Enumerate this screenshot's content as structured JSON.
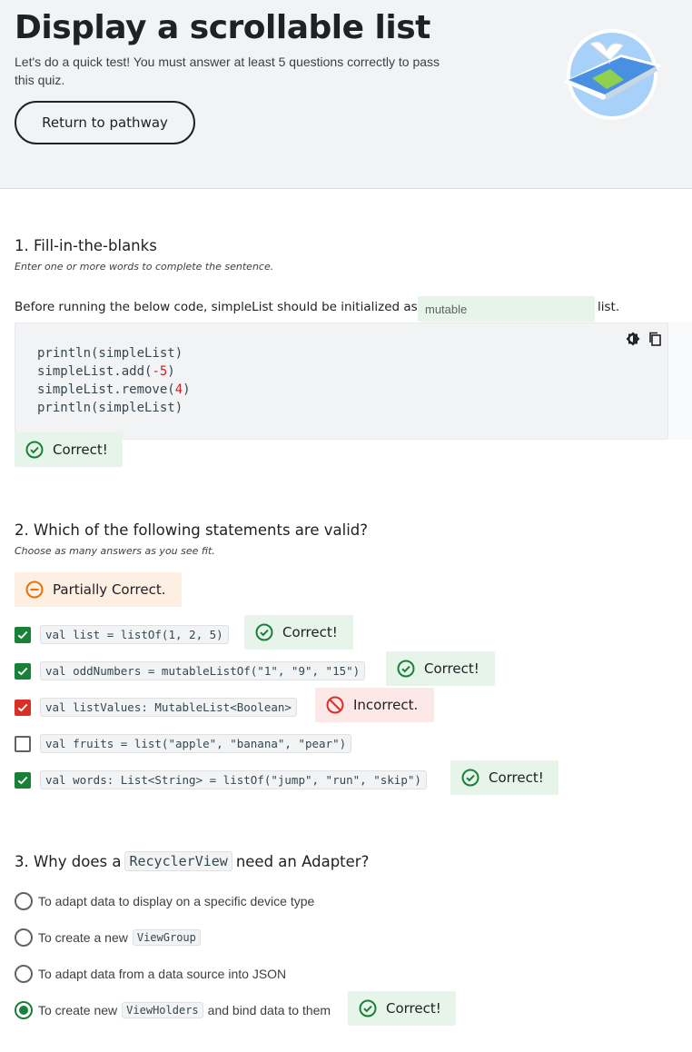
{
  "header": {
    "title": "Display a scrollable list",
    "subtitle": "Let's do a quick test! You must answer at least 5 questions correctly to pass this quiz.",
    "return_button": "Return to pathway"
  },
  "q1": {
    "title": "1. Fill-in-the-blanks",
    "hint": "Enter one or more words to complete the sentence.",
    "sentence_prefix": "Before running the below code, simpleList should be initialized as a",
    "input_value": "mutable",
    "sentence_suffix": "list.",
    "code": {
      "line1": "println(simpleList)",
      "line2_a": "simpleList.add(",
      "line2_num": "-5",
      "line2_b": ")",
      "line3_a": "simpleList.remove(",
      "line3_num": "4",
      "line3_b": ")",
      "line4": "println(simpleList)"
    },
    "result": "Correct!"
  },
  "q2": {
    "title": "2. Which of the following statements are valid?",
    "hint": "Choose as many answers as you see fit.",
    "overall_result": "Partially Correct.",
    "options": [
      {
        "code": "val list = listOf(1, 2, 5)",
        "checked": true,
        "result": "Correct!"
      },
      {
        "code": "val oddNumbers = mutableListOf(\"1\", \"9\", \"15\")",
        "checked": true,
        "result": "Correct!"
      },
      {
        "code": "val listValues: MutableList<Boolean>",
        "checked": true,
        "result": "Incorrect."
      },
      {
        "code": "val fruits = list(\"apple\", \"banana\", \"pear\")",
        "checked": false,
        "result": ""
      },
      {
        "code": "val words: List<String> = listOf(\"jump\", \"run\", \"skip\")",
        "checked": true,
        "result": "Correct!"
      }
    ]
  },
  "q3": {
    "title_prefix": "3. Why does a",
    "title_code": "RecyclerView",
    "title_suffix": "need an Adapter?",
    "options": {
      "o1": "To adapt data to display on a specific device type",
      "o2_prefix": "To create a new",
      "o2_code": "ViewGroup",
      "o3": "To adapt data from a data source into JSON",
      "o4_prefix": "To create new",
      "o4_code": "ViewHolders",
      "o4_suffix": "and bind data to them"
    },
    "result": "Correct!"
  },
  "colors": {
    "correct_green": "#188038",
    "incorrect_red": "#d93025",
    "partial_orange": "#e8710a"
  },
  "icons": [
    "illustration-phone-bird-icon",
    "theme-toggle-icon",
    "copy-icon",
    "check-circle-icon",
    "minus-circle-icon",
    "block-icon",
    "checkmark-icon"
  ]
}
